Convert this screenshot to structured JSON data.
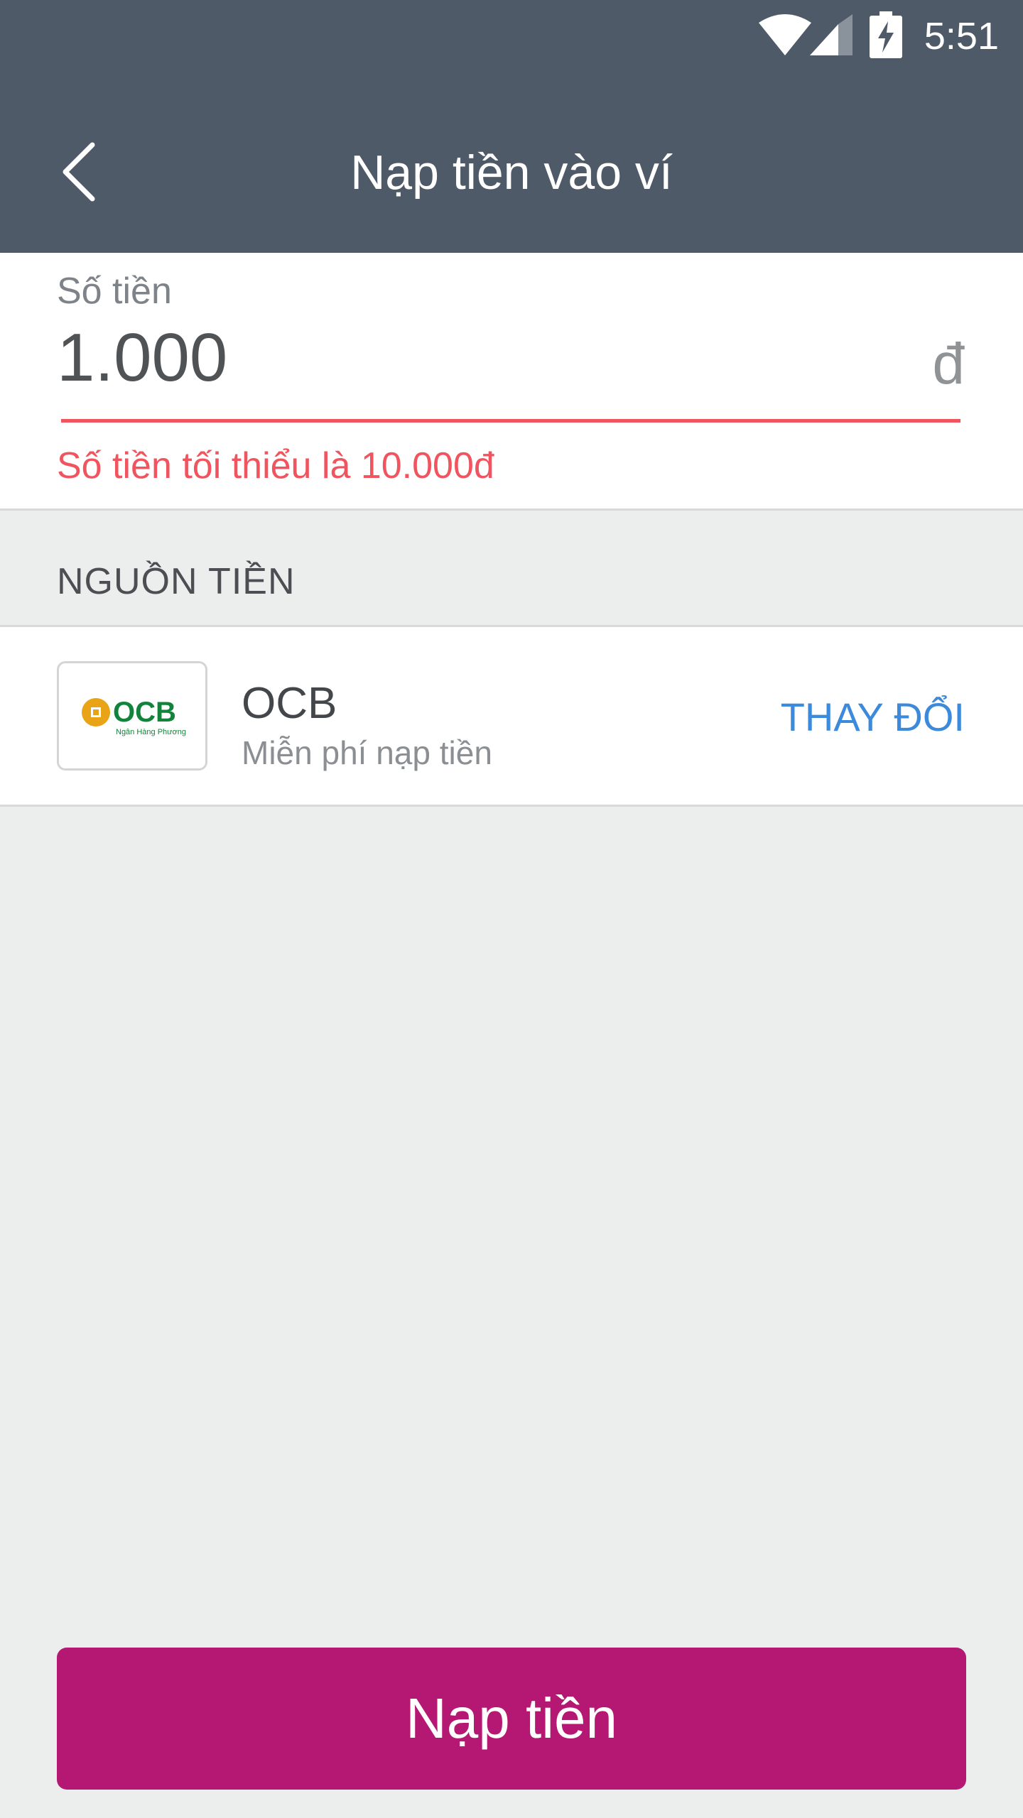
{
  "status_bar": {
    "time": "5:51",
    "icons": [
      "wifi-icon",
      "signal-icon",
      "battery-charging-icon"
    ]
  },
  "header": {
    "title": "Nạp tiền vào ví",
    "back_icon": "chevron-left-icon"
  },
  "amount": {
    "label": "Số tiền",
    "value": "1.000",
    "currency": "đ",
    "error": "Số tiền tối thiểu là 10.000đ"
  },
  "source": {
    "section_title": "NGUỒN TIỀN",
    "bank_name": "OCB",
    "description": "Miễn phí nạp tiền",
    "change_label": "THAY ĐỔI",
    "logo": {
      "text": "OCB",
      "tagline": "Ngân Hàng Phương Đông"
    }
  },
  "submit": {
    "label": "Nạp tiền"
  },
  "colors": {
    "header": "#4F5A68",
    "error": "#F0545F",
    "link": "#3C8ADB",
    "primary_button": "#B51873",
    "background": "#ECEDED"
  }
}
